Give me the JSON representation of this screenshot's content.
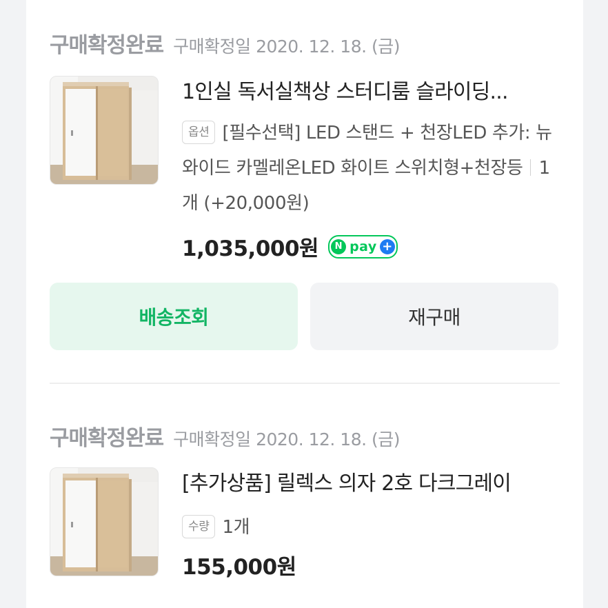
{
  "orders": [
    {
      "status": "구매확정완료",
      "date_text": "구매확정일 2020. 12. 18. (금)",
      "product_name": "1인실 독서실책상 스터디룸 슬라이딩...",
      "option_badge": "옵션",
      "option_text": "[필수선택] LED 스탠드 + 천장LED 추가: 뉴와이드 카멜레온LED 화이트 스위치형+천장등",
      "quantity": "1개 (+20,000원)",
      "price": "1,035,000원",
      "npay": {
        "n": "N",
        "text": "pay",
        "plus": "+"
      },
      "buttons": {
        "track": "배송조회",
        "rebuy": "재구매"
      }
    },
    {
      "status": "구매확정완료",
      "date_text": "구매확정일 2020. 12. 18. (금)",
      "product_name": "[추가상품] 릴렉스 의자 2호 다크그레이",
      "option_badge": "수량",
      "quantity": "1개",
      "price": "155,000원"
    }
  ],
  "colors": {
    "accent_green": "#12b564",
    "npay_green": "#03c75a",
    "npay_blue": "#1e7cf2",
    "track_button_bg": "#e6f7ee",
    "rebuy_button_bg": "#f2f3f5"
  },
  "icons": {
    "npay_logo": "npay-logo-icon",
    "product_image": "sliding-door-booth-image"
  }
}
